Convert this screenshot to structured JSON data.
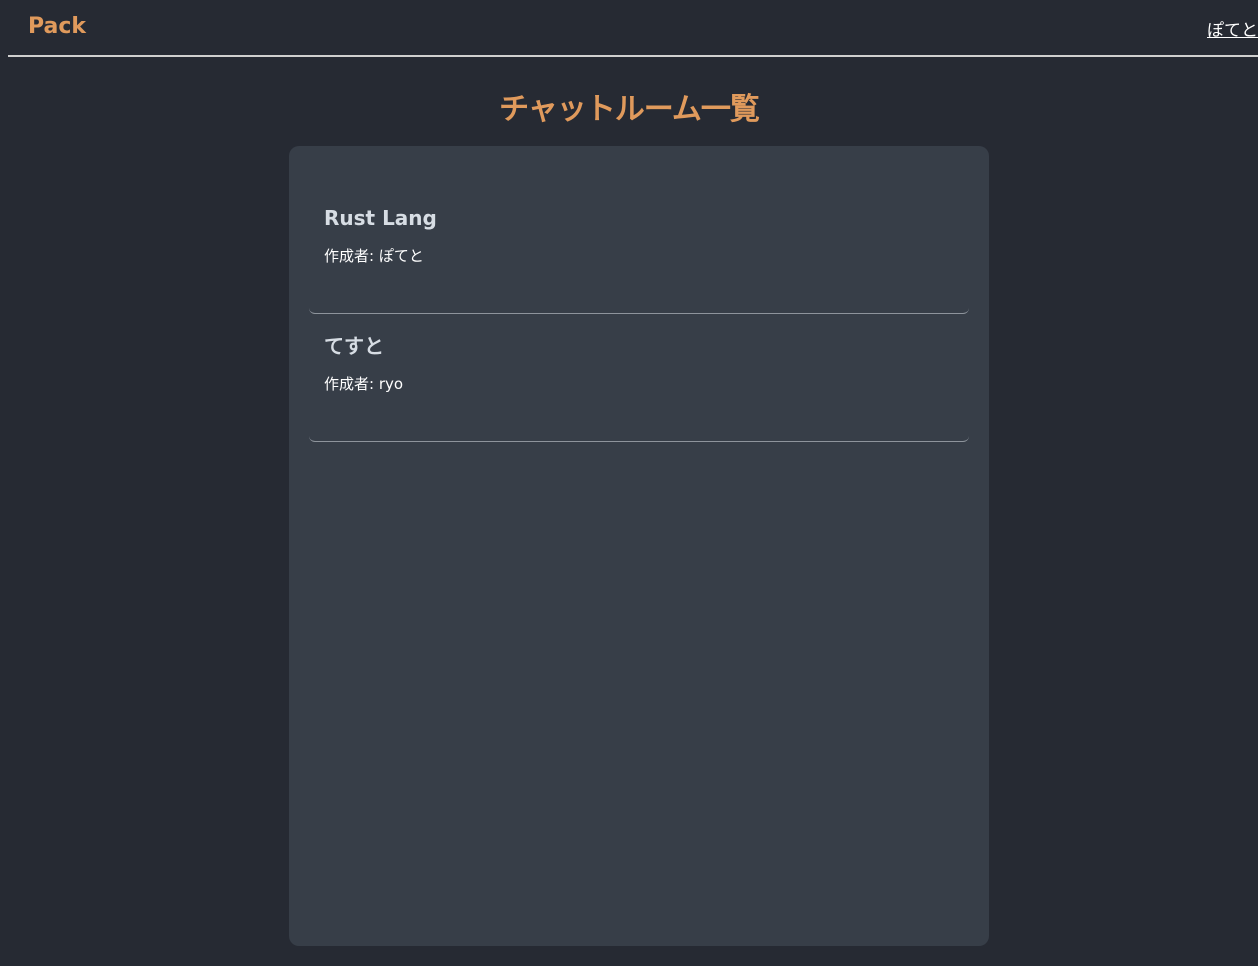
{
  "header": {
    "brand": "Pack",
    "user_name": "ぽてと"
  },
  "page": {
    "title": "チャットルーム一覧"
  },
  "rooms": [
    {
      "name": "Rust Lang",
      "creator_label": "作成者:",
      "creator": "ぽてと"
    },
    {
      "name": "てすと",
      "creator_label": "作成者:",
      "creator": "ryo"
    }
  ],
  "colors": {
    "background": "#262a33",
    "panel": "#373e48",
    "accent": "#e09a5c"
  }
}
